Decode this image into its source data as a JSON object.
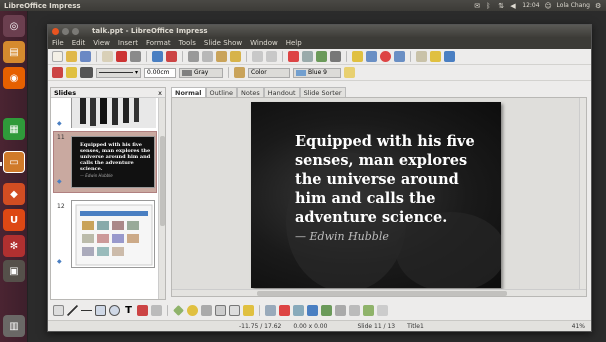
{
  "panel": {
    "app_name": "LibreOffice Impress",
    "clock": "12:04",
    "user": "Lola Chang"
  },
  "launcher": {
    "items": [
      {
        "name": "dash-home",
        "glyph": "◎",
        "color": "#6b3f4f"
      },
      {
        "name": "files",
        "glyph": "▤",
        "color": "#d58a2e"
      },
      {
        "name": "firefox",
        "glyph": "◉",
        "color": "#e66000"
      },
      {
        "name": "libreoffice-calc",
        "glyph": "▦",
        "color": "#2f9a3a"
      },
      {
        "name": "libreoffice-impress",
        "glyph": "▭",
        "color": "#d07a2a"
      },
      {
        "name": "software-center",
        "glyph": "◆",
        "color": "#d24d22"
      },
      {
        "name": "ubuntu-one",
        "glyph": "U",
        "color": "#dd4814"
      },
      {
        "name": "system-settings",
        "glyph": "✻",
        "color": "#b03030"
      },
      {
        "name": "workspace-switcher",
        "glyph": "▣",
        "color": "#55504a"
      },
      {
        "name": "trash",
        "glyph": "▥",
        "color": "#6a6866"
      }
    ]
  },
  "window": {
    "title": "talk.ppt - LibreOffice Impress",
    "menu": [
      "File",
      "Edit",
      "View",
      "Insert",
      "Format",
      "Tools",
      "Slide Show",
      "Window",
      "Help"
    ]
  },
  "line_toolbar": {
    "line_width": "0.00cm",
    "line_color": "Gray",
    "area_style": "Color",
    "area_color": "Blue 9"
  },
  "slides_pane": {
    "title": "Slides",
    "close": "x",
    "slides": [
      {
        "number": ""
      },
      {
        "number": "11",
        "text": "Equipped with his five senses, man explores the universe around him and calls the adventure science.",
        "author": "— Edwin Hubble"
      },
      {
        "number": "12"
      }
    ]
  },
  "view_tabs": [
    "Normal",
    "Outline",
    "Notes",
    "Handout",
    "Slide Sorter"
  ],
  "slide": {
    "quote": "Equipped with his five senses, man explores the universe around him and calls the adventure science.",
    "author": "— Edwin Hubble"
  },
  "status": {
    "position": "-11.75 / 17.62",
    "size": "0.00 x 0.00",
    "slide": "Slide 11 / 13",
    "layout": "Title1",
    "zoom": "41%"
  }
}
